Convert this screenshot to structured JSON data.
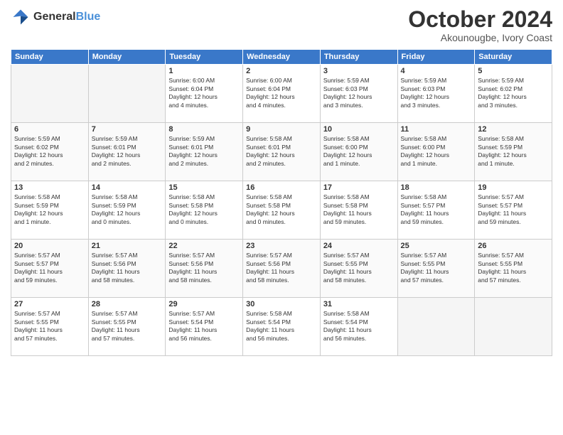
{
  "logo": {
    "text_general": "General",
    "text_blue": "Blue"
  },
  "header": {
    "month": "October 2024",
    "location": "Akounougbe, Ivory Coast"
  },
  "days_of_week": [
    "Sunday",
    "Monday",
    "Tuesday",
    "Wednesday",
    "Thursday",
    "Friday",
    "Saturday"
  ],
  "weeks": [
    [
      {
        "day": "",
        "info": ""
      },
      {
        "day": "",
        "info": ""
      },
      {
        "day": "1",
        "info": "Sunrise: 6:00 AM\nSunset: 6:04 PM\nDaylight: 12 hours\nand 4 minutes."
      },
      {
        "day": "2",
        "info": "Sunrise: 6:00 AM\nSunset: 6:04 PM\nDaylight: 12 hours\nand 4 minutes."
      },
      {
        "day": "3",
        "info": "Sunrise: 5:59 AM\nSunset: 6:03 PM\nDaylight: 12 hours\nand 3 minutes."
      },
      {
        "day": "4",
        "info": "Sunrise: 5:59 AM\nSunset: 6:03 PM\nDaylight: 12 hours\nand 3 minutes."
      },
      {
        "day": "5",
        "info": "Sunrise: 5:59 AM\nSunset: 6:02 PM\nDaylight: 12 hours\nand 3 minutes."
      }
    ],
    [
      {
        "day": "6",
        "info": "Sunrise: 5:59 AM\nSunset: 6:02 PM\nDaylight: 12 hours\nand 2 minutes."
      },
      {
        "day": "7",
        "info": "Sunrise: 5:59 AM\nSunset: 6:01 PM\nDaylight: 12 hours\nand 2 minutes."
      },
      {
        "day": "8",
        "info": "Sunrise: 5:59 AM\nSunset: 6:01 PM\nDaylight: 12 hours\nand 2 minutes."
      },
      {
        "day": "9",
        "info": "Sunrise: 5:58 AM\nSunset: 6:01 PM\nDaylight: 12 hours\nand 2 minutes."
      },
      {
        "day": "10",
        "info": "Sunrise: 5:58 AM\nSunset: 6:00 PM\nDaylight: 12 hours\nand 1 minute."
      },
      {
        "day": "11",
        "info": "Sunrise: 5:58 AM\nSunset: 6:00 PM\nDaylight: 12 hours\nand 1 minute."
      },
      {
        "day": "12",
        "info": "Sunrise: 5:58 AM\nSunset: 5:59 PM\nDaylight: 12 hours\nand 1 minute."
      }
    ],
    [
      {
        "day": "13",
        "info": "Sunrise: 5:58 AM\nSunset: 5:59 PM\nDaylight: 12 hours\nand 1 minute."
      },
      {
        "day": "14",
        "info": "Sunrise: 5:58 AM\nSunset: 5:59 PM\nDaylight: 12 hours\nand 0 minutes."
      },
      {
        "day": "15",
        "info": "Sunrise: 5:58 AM\nSunset: 5:58 PM\nDaylight: 12 hours\nand 0 minutes."
      },
      {
        "day": "16",
        "info": "Sunrise: 5:58 AM\nSunset: 5:58 PM\nDaylight: 12 hours\nand 0 minutes."
      },
      {
        "day": "17",
        "info": "Sunrise: 5:58 AM\nSunset: 5:58 PM\nDaylight: 11 hours\nand 59 minutes."
      },
      {
        "day": "18",
        "info": "Sunrise: 5:58 AM\nSunset: 5:57 PM\nDaylight: 11 hours\nand 59 minutes."
      },
      {
        "day": "19",
        "info": "Sunrise: 5:57 AM\nSunset: 5:57 PM\nDaylight: 11 hours\nand 59 minutes."
      }
    ],
    [
      {
        "day": "20",
        "info": "Sunrise: 5:57 AM\nSunset: 5:57 PM\nDaylight: 11 hours\nand 59 minutes."
      },
      {
        "day": "21",
        "info": "Sunrise: 5:57 AM\nSunset: 5:56 PM\nDaylight: 11 hours\nand 58 minutes."
      },
      {
        "day": "22",
        "info": "Sunrise: 5:57 AM\nSunset: 5:56 PM\nDaylight: 11 hours\nand 58 minutes."
      },
      {
        "day": "23",
        "info": "Sunrise: 5:57 AM\nSunset: 5:56 PM\nDaylight: 11 hours\nand 58 minutes."
      },
      {
        "day": "24",
        "info": "Sunrise: 5:57 AM\nSunset: 5:55 PM\nDaylight: 11 hours\nand 58 minutes."
      },
      {
        "day": "25",
        "info": "Sunrise: 5:57 AM\nSunset: 5:55 PM\nDaylight: 11 hours\nand 57 minutes."
      },
      {
        "day": "26",
        "info": "Sunrise: 5:57 AM\nSunset: 5:55 PM\nDaylight: 11 hours\nand 57 minutes."
      }
    ],
    [
      {
        "day": "27",
        "info": "Sunrise: 5:57 AM\nSunset: 5:55 PM\nDaylight: 11 hours\nand 57 minutes."
      },
      {
        "day": "28",
        "info": "Sunrise: 5:57 AM\nSunset: 5:55 PM\nDaylight: 11 hours\nand 57 minutes."
      },
      {
        "day": "29",
        "info": "Sunrise: 5:57 AM\nSunset: 5:54 PM\nDaylight: 11 hours\nand 56 minutes."
      },
      {
        "day": "30",
        "info": "Sunrise: 5:58 AM\nSunset: 5:54 PM\nDaylight: 11 hours\nand 56 minutes."
      },
      {
        "day": "31",
        "info": "Sunrise: 5:58 AM\nSunset: 5:54 PM\nDaylight: 11 hours\nand 56 minutes."
      },
      {
        "day": "",
        "info": ""
      },
      {
        "day": "",
        "info": ""
      }
    ]
  ]
}
